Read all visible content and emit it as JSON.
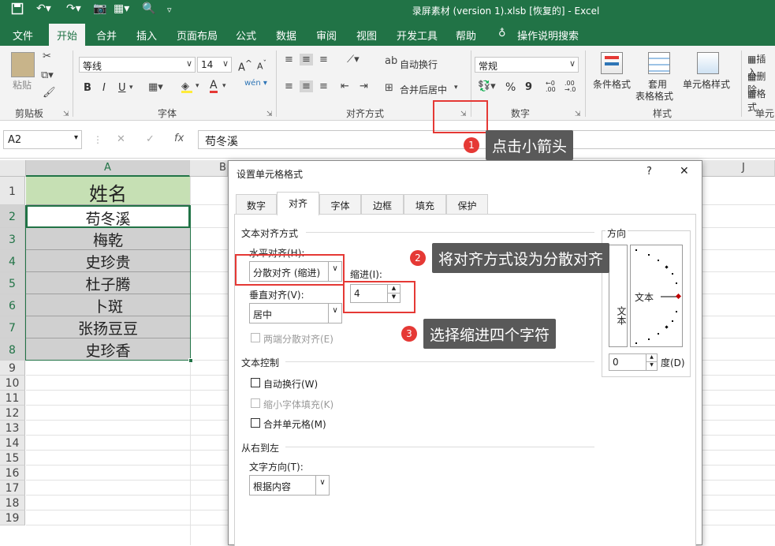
{
  "window": {
    "title": "录屏素材 (version 1).xlsb [恢复的]  -  Excel"
  },
  "ribbon_tabs": [
    "文件",
    "开始",
    "合并",
    "插入",
    "页面布局",
    "公式",
    "数据",
    "审阅",
    "视图",
    "开发工具",
    "帮助",
    "操作说明搜索"
  ],
  "ribbon": {
    "paste": "粘贴",
    "clipboard": "剪贴板",
    "font_name": "等线",
    "font_size": "14",
    "font_grp": "字体",
    "bold": "B",
    "italic": "I",
    "underline": "U",
    "font_a": "A",
    "font_grow": "A",
    "font_shrink": "A",
    "wen": "wén",
    "wrap": "自动换行",
    "merge": "合并后居中",
    "align_grp": "对齐方式",
    "num_format": "常规",
    "percent": "%",
    "comma": "9",
    "num_grp": "数字",
    "dec_up": ".00",
    "cond_fmt": "条件格式",
    "table_fmt_1": "套用",
    "table_fmt_2": "表格格式",
    "cell_style": "单元格样式",
    "style_grp": "样式",
    "insert": "插入",
    "delete": "删除",
    "format": "格式",
    "cells_grp": "单元"
  },
  "formula_bar": {
    "namebox": "A2",
    "fx": "fx",
    "content": "苟冬溪",
    "cancel": "✕",
    "enter": "✓"
  },
  "sheet": {
    "columns": [
      "A",
      "B",
      "J"
    ],
    "rows": [
      "1",
      "2",
      "3",
      "4",
      "5",
      "6",
      "7",
      "8",
      "9",
      "10",
      "11",
      "12",
      "13",
      "14",
      "15",
      "16",
      "17",
      "18",
      "19"
    ],
    "cells": [
      "姓名",
      "苟冬溪",
      "梅乾",
      "史珍贵",
      "杜子腾",
      "卜斑",
      "张扬豆豆",
      "史珍香"
    ]
  },
  "dialog": {
    "title": "设置单元格格式",
    "help": "?",
    "close": "✕",
    "tabs": [
      "数字",
      "对齐",
      "字体",
      "边框",
      "填充",
      "保护"
    ],
    "text_align_section": "文本对齐方式",
    "horizontal_label": "水平对齐(H):",
    "horizontal_value": "分散对齐 (缩进)",
    "vertical_label": "垂直对齐(V):",
    "vertical_value": "居中",
    "indent_label": "缩进(I):",
    "indent_value": "4",
    "justify_distributed": "两端分散对齐(E)",
    "text_control_section": "文本控制",
    "wrap_text": "自动换行(W)",
    "shrink_fit": "缩小字体填充(K)",
    "merge_cells": "合并单元格(M)",
    "rtl_section": "从右到左",
    "text_direction_label": "文字方向(T):",
    "text_direction_value": "根据内容",
    "orientation_section": "方向",
    "orientation_vertical_text": "文本",
    "orientation_text": "文本",
    "degree_value": "0",
    "degree_label": "度(D)"
  },
  "annotations": [
    {
      "num": "1",
      "text": "点击小箭头"
    },
    {
      "num": "2",
      "text": "将对齐方式设为分散对齐"
    },
    {
      "num": "3",
      "text": "选择缩进四个字符"
    }
  ],
  "colors": {
    "excel_green": "#217346",
    "header_fill": "#c6e0b4",
    "selected_fill": "#d0d0d0",
    "annotation_red": "#e53935",
    "tooltip_bg": "#595959"
  }
}
